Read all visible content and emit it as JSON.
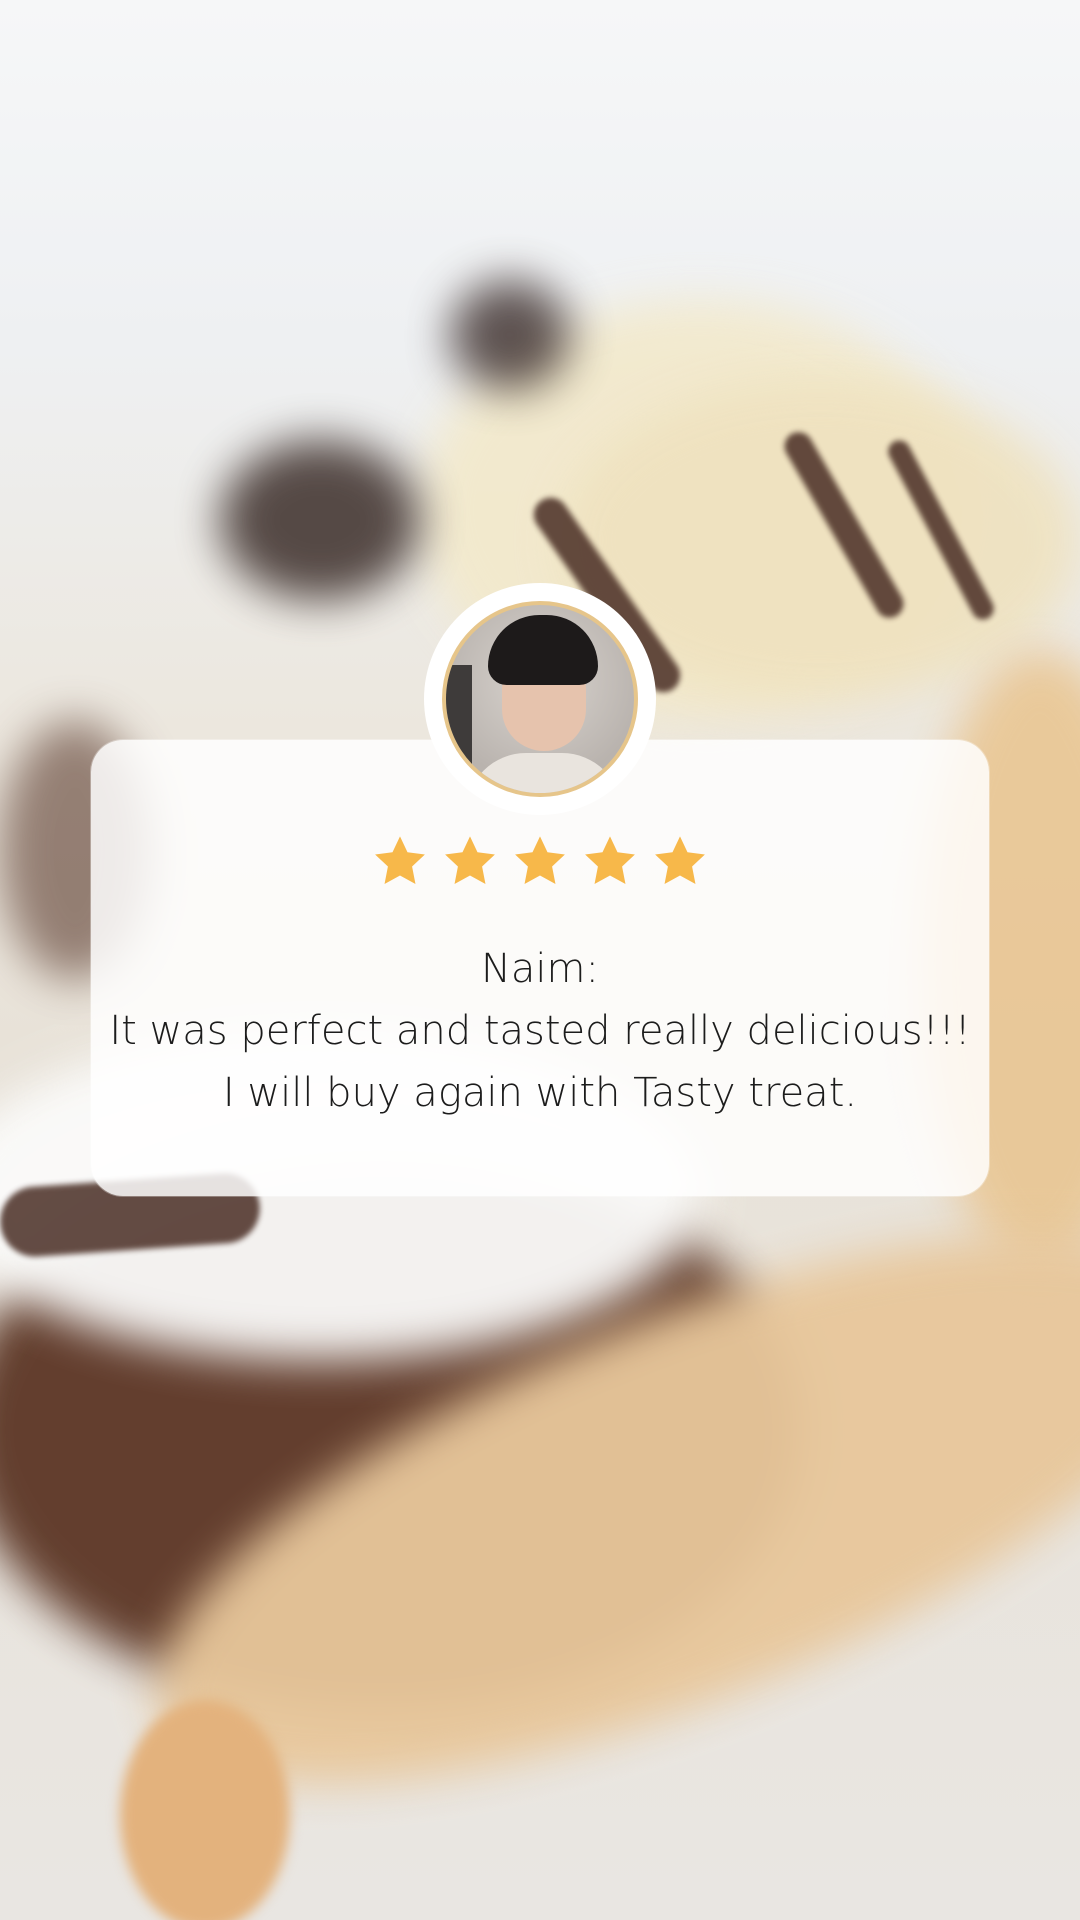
{
  "review": {
    "reviewer": "Naim:",
    "line1": "It was perfect and tasted really delicious!!!",
    "line2": "I will buy again with Tasty treat.",
    "rating": 5,
    "rating_max": 5
  },
  "colors": {
    "star": "#f7b84a",
    "avatar_border": "#e6c58a",
    "card_bg": "#ffffff"
  },
  "icons": {
    "star": "star-icon",
    "avatar": "avatar"
  }
}
